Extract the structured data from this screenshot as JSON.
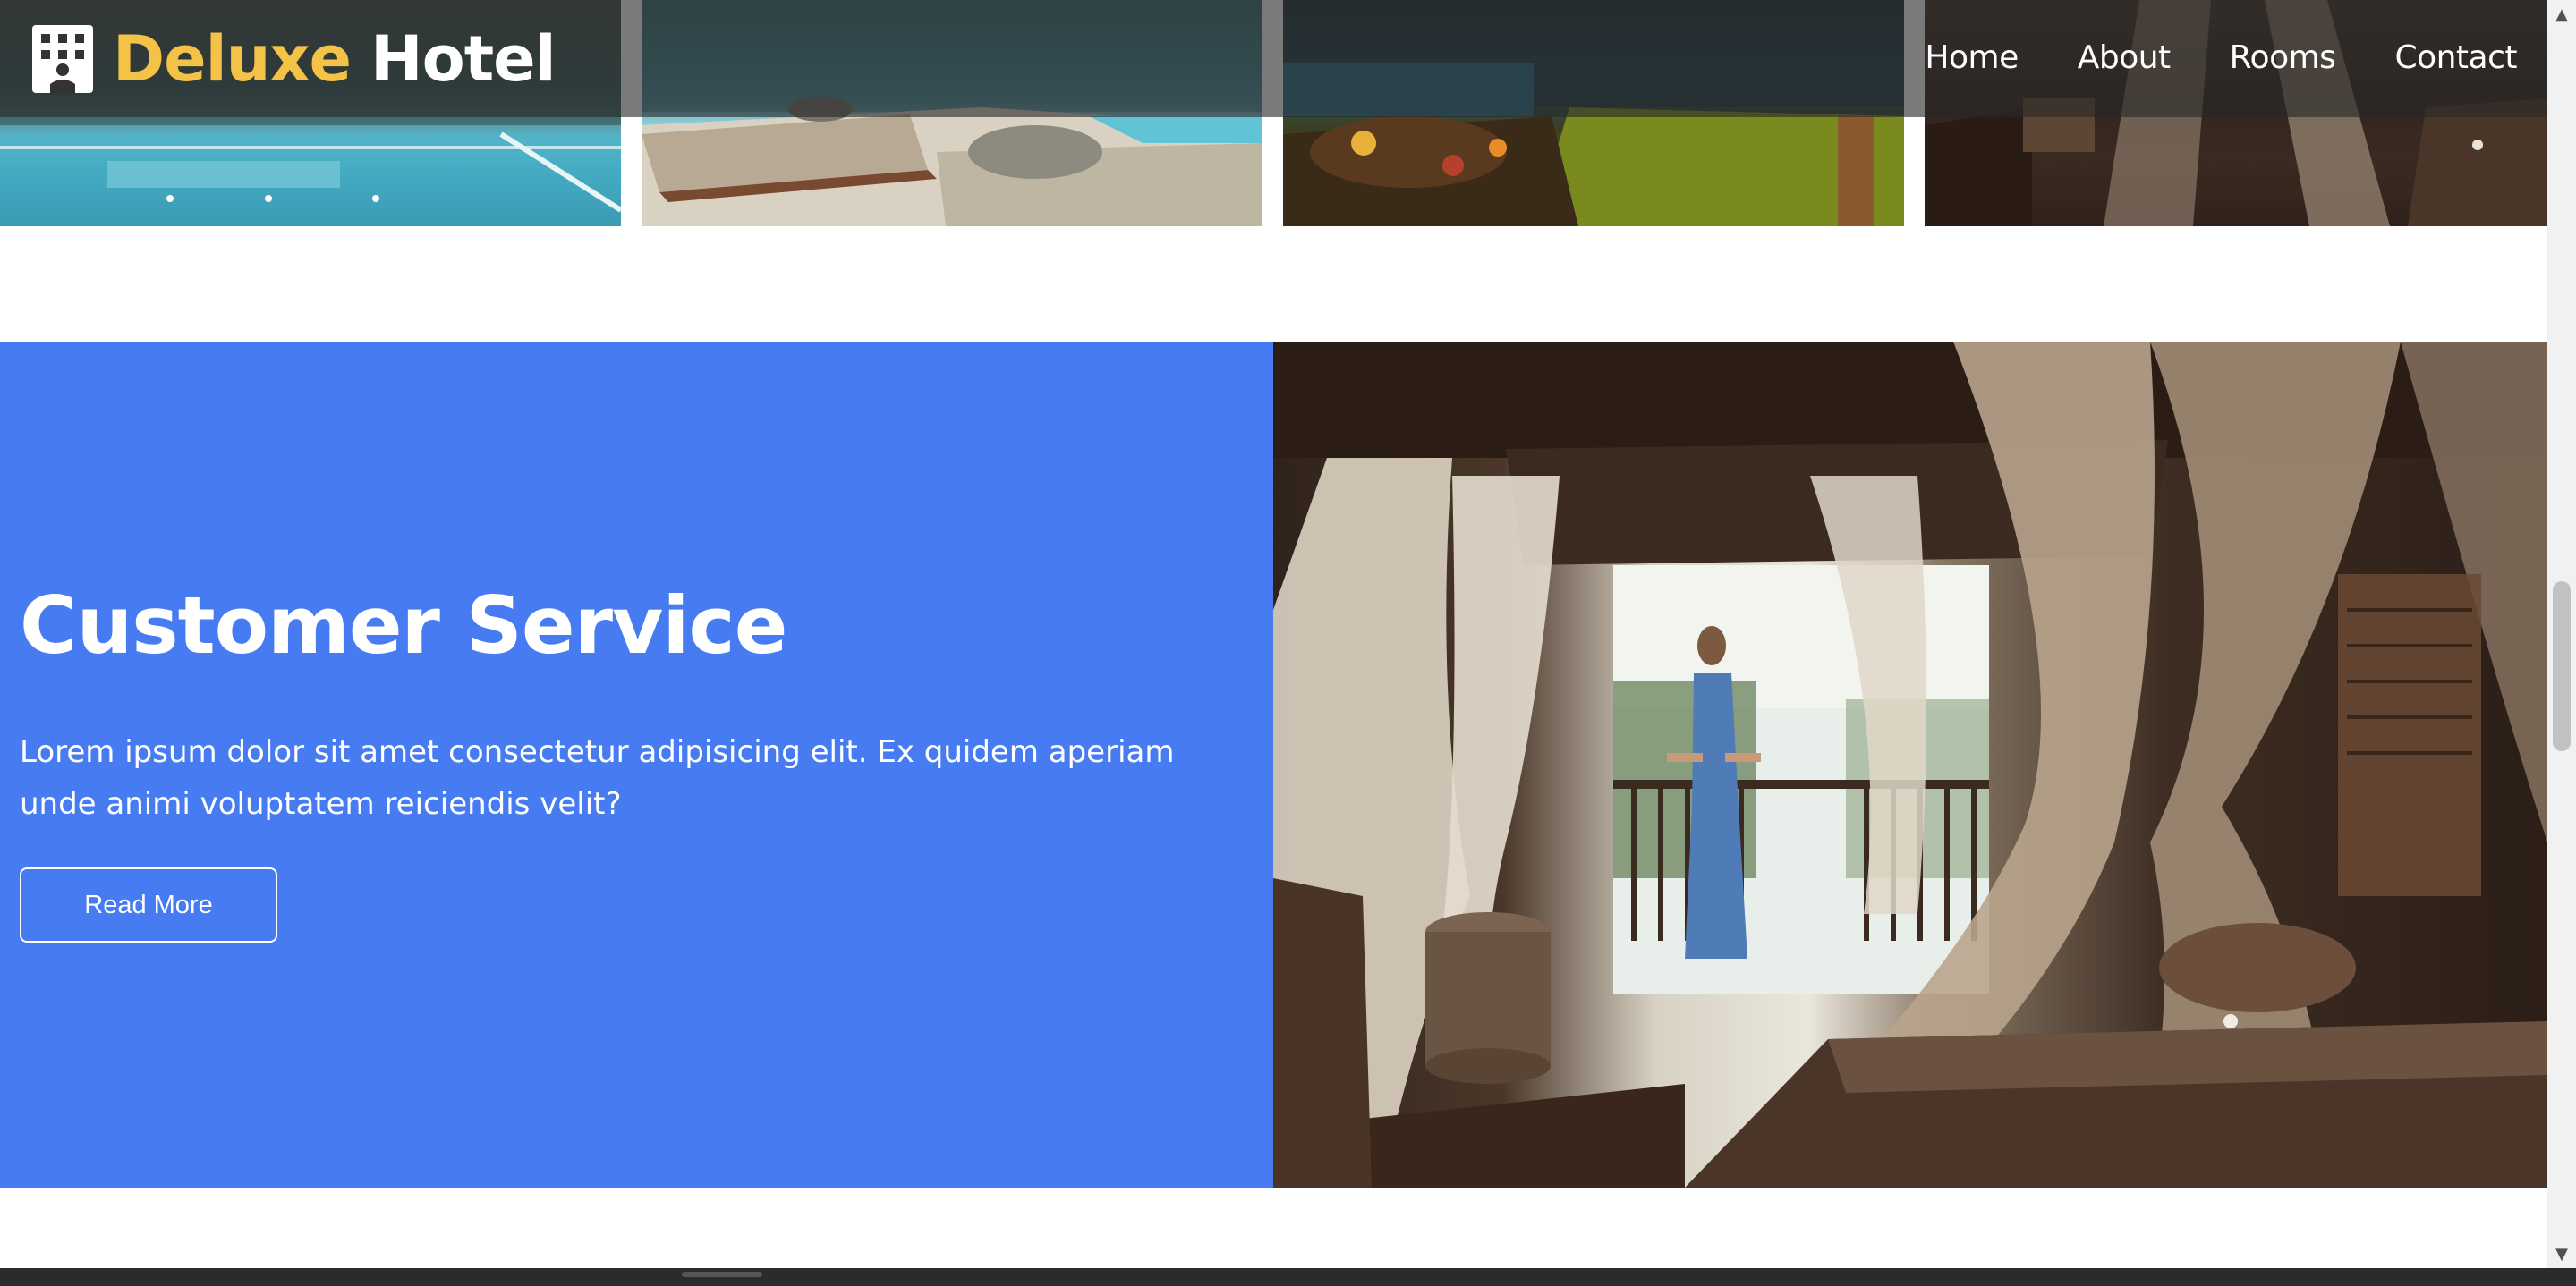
{
  "brand": {
    "accent": "Deluxe",
    "main": "Hotel",
    "icon": "hotel-building-icon",
    "accent_color": "#f3c247"
  },
  "nav": {
    "items": [
      "Home",
      "About",
      "Rooms",
      "Contact"
    ]
  },
  "gallery": {
    "images": [
      "pool-image",
      "poolside-lounger-image",
      "dinner-terrace-image",
      "bedroom-canopy-image"
    ]
  },
  "service": {
    "title": "Customer Service",
    "text": "Lorem ipsum dolor sit amet consectetur adipisicing elit. Ex quidem aperiam unde animi voluptatem reiciendis velit?",
    "button": "Read More",
    "background": "#477bf1",
    "image": "resort-bedroom-woman-balcony-image"
  },
  "scrollbar": {
    "up": "▲",
    "down": "▼"
  }
}
